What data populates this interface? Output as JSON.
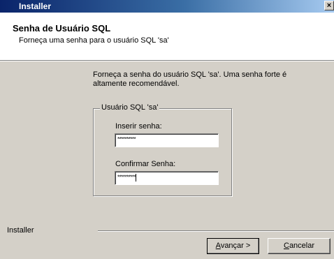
{
  "window": {
    "title": "Installer",
    "close_glyph": "×"
  },
  "header": {
    "title": "Senha de Usuário SQL",
    "subtitle": "Forneça uma senha para o usuário SQL 'sa'"
  },
  "body": {
    "instruction": "Forneça a senha do usuário SQL 'sa'. Uma senha forte é altamente recomendável.",
    "group_title": "Usuário SQL 'sa'",
    "password_label": "Inserir senha:",
    "password_value": "**********",
    "confirm_label": "Confirmar Senha:",
    "confirm_value": "**********"
  },
  "footer": {
    "brand": "Installer",
    "next_label_key": "A",
    "next_label_rest": "vançar >",
    "cancel_label_key": "C",
    "cancel_label_rest": "ancelar"
  }
}
